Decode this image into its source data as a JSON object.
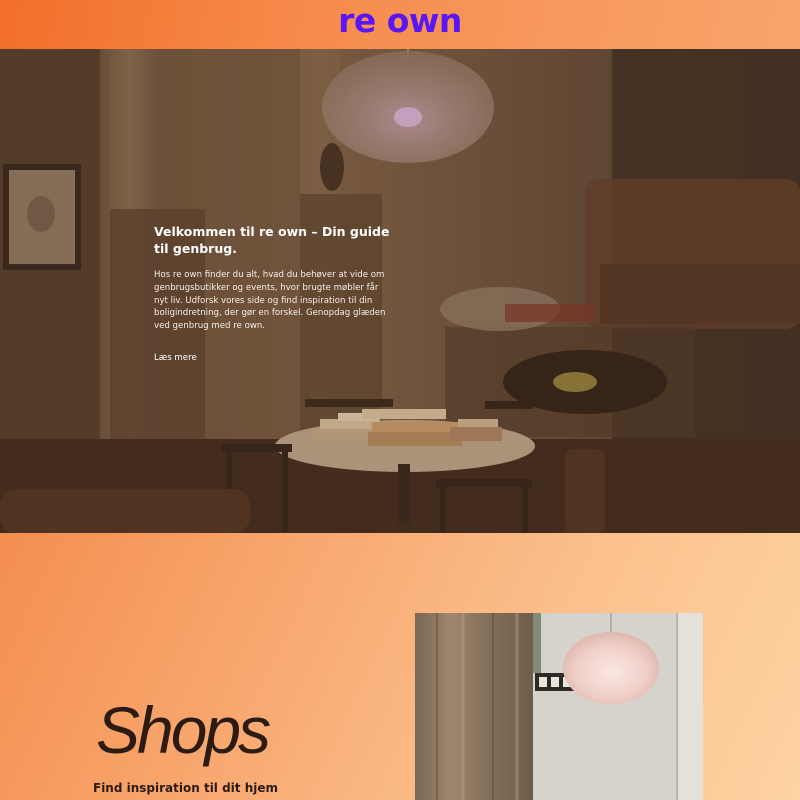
{
  "header": {
    "logo": "re own"
  },
  "hero": {
    "title": "Velkommen til re own – Din guide til genbrug.",
    "text": "Hos re own finder du alt, hvad du behøver at vide om genbrugsbutikker og events, hvor brugte møbler får nyt liv. Udforsk vores side og find inspiration til din boligindretning, der gør en forskel. Genopdag glæden ved genbrug med re own.",
    "link_label": "Læs mere"
  },
  "shops": {
    "title": "Shops",
    "subtitle": "Find inspiration til dit hjem"
  },
  "colors": {
    "logo": "#5a16f5",
    "gradient_start": "#f07a36",
    "gradient_end": "#fdd4a2",
    "text_dark": "#2c1b12"
  }
}
